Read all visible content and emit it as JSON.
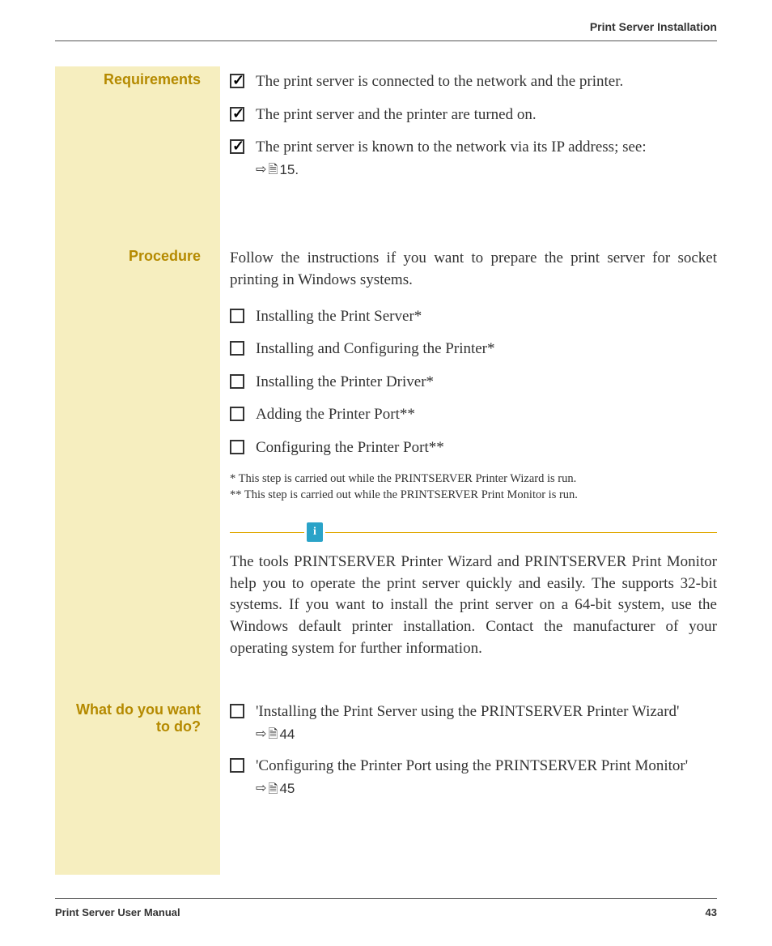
{
  "header": {
    "title": "Print Server Installation"
  },
  "requirements": {
    "label": "Requirements",
    "items": [
      {
        "text": "The print server is connected to the network and the printer."
      },
      {
        "text": "The print server and the printer are turned on."
      },
      {
        "text": "The print server is known to the network via its IP address; see:",
        "ref": "15."
      }
    ]
  },
  "procedure": {
    "label": "Procedure",
    "intro": "Follow the instructions if you want to prepare the print server for socket printing in Windows systems.",
    "steps": [
      "Installing the Print Server*",
      "Installing and Configuring the Printer*",
      "Installing the Printer Driver*",
      "Adding the Printer Port**",
      "Configuring the Printer Port**"
    ],
    "footnote1": "* This step is carried out while the PRINTSERVER Printer Wizard is run.",
    "footnote2": "** This step is carried out while the PRINTSERVER Print Monitor is run.",
    "info": "The tools PRINTSERVER Printer Wizard and PRINTSERVER Print Monitor help you to operate the print server quickly and easily. The supports 32-bit systems. If you want to install the print server on a 64-bit system, use the Windows default printer installation. Contact the manufacturer of your operating system for further information."
  },
  "whattodo": {
    "label_line1": "What do you want",
    "label_line2": "to do?",
    "items": [
      {
        "text": "'Installing the Print Server using the PRINTSERVER Printer Wizard'",
        "ref": "44"
      },
      {
        "text": "'Configuring the Printer Port using the PRINTSERVER Print Monitor'",
        "ref": "45"
      }
    ]
  },
  "footer": {
    "left": "Print Server User Manual",
    "right": "43"
  }
}
